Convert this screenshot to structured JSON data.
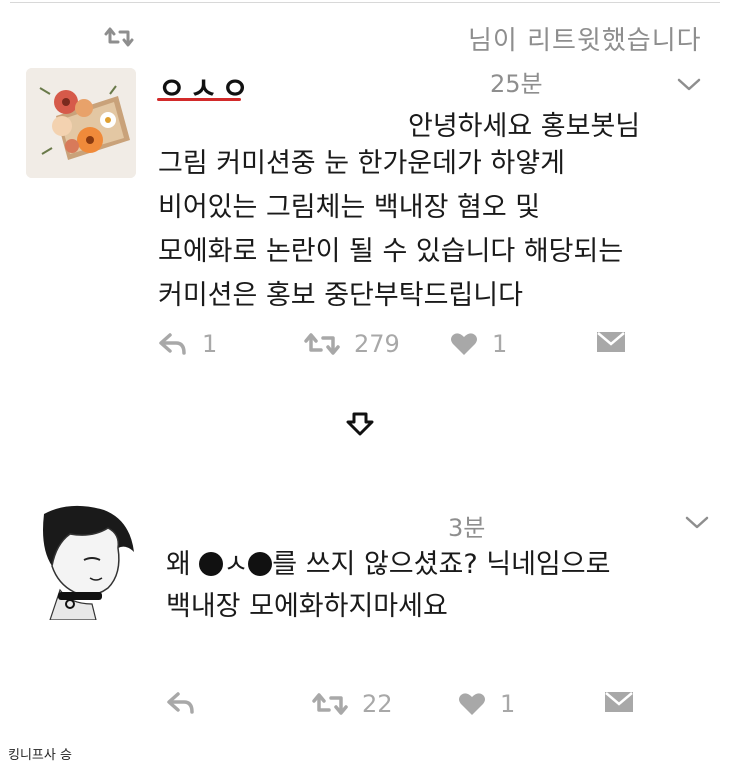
{
  "retweet_header": {
    "text": "님이 리트윗했습니다",
    "icon": "retweet-icon"
  },
  "tweets": [
    {
      "username": "ㅇㅅㅇ",
      "timestamp": "25분",
      "body_lines": [
        "안녕하세요 홍보봇님",
        "그림 커미션중 눈 한가운데가 하얗게",
        "비어있는 그림체는 백내장 혐오 및",
        "모에화로 논란이 될 수 있습니다 해당되는",
        "커미션은 홍보 중단부탁드립니다"
      ],
      "actions": {
        "reply_count": "1",
        "retweet_count": "279",
        "like_count": "1"
      }
    },
    {
      "timestamp": "3분",
      "body": {
        "line1_prefix": "왜 ",
        "line1_middle": "ㅅ",
        "line1_suffix": "를 쓰지 않으셨죠? 닉네임으로",
        "line2": "백내장 모에화하지마세요"
      },
      "actions": {
        "retweet_count": "22",
        "like_count": "1"
      }
    }
  ],
  "footer": {
    "caption": "킹니프사 승"
  },
  "colors": {
    "muted_gray": "#a8a8a8",
    "timestamp_gray": "#8e8e8e",
    "underline_red": "#d22a2a"
  }
}
